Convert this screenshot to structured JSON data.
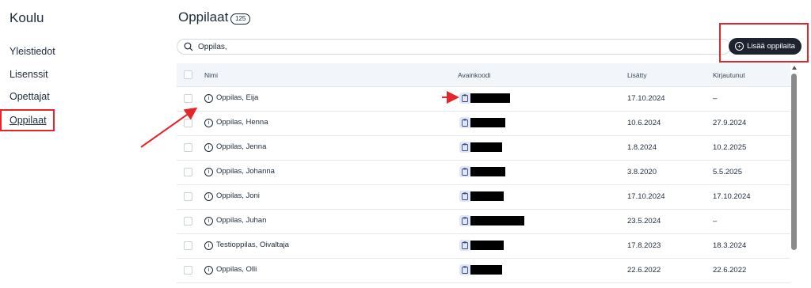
{
  "sidebar": {
    "title": "Koulu",
    "items": [
      {
        "label": "Yleistiedot"
      },
      {
        "label": "Lisenssit"
      },
      {
        "label": "Opettajat"
      },
      {
        "label": "Oppilaat",
        "active": true
      }
    ]
  },
  "main": {
    "title": "Oppilaat",
    "count": "125",
    "search": {
      "value": "Oppilas,",
      "icon": "search-icon"
    },
    "add_button": {
      "label": "Lisää oppilaita",
      "icon": "plus-circle-icon"
    }
  },
  "table": {
    "columns": [
      "Nimi",
      "Avainkoodi",
      "Lisätty",
      "Kirjautunut"
    ],
    "rows": [
      {
        "name": "Oppilas, Eija",
        "added": "17.10.2024",
        "logged_in": "–"
      },
      {
        "name": "Oppilas, Henna",
        "added": "10.6.2024",
        "logged_in": "27.9.2024"
      },
      {
        "name": "Oppilas, Jenna",
        "added": "1.8.2024",
        "logged_in": "10.2.2025"
      },
      {
        "name": "Oppilas, Johanna",
        "added": "3.8.2020",
        "logged_in": "5.5.2025"
      },
      {
        "name": "Oppilas, Joni",
        "added": "17.10.2024",
        "logged_in": "17.10.2024"
      },
      {
        "name": "Oppilas, Juhan",
        "added": "23.5.2024",
        "logged_in": "–"
      },
      {
        "name": "Testioppilas, Oivaltaja",
        "added": "17.8.2023",
        "logged_in": "18.3.2024"
      },
      {
        "name": "Oppilas, Olli",
        "added": "22.6.2022",
        "logged_in": "22.6.2022"
      }
    ]
  },
  "colors": {
    "accent_dark": "#1d2430",
    "annotation_red": "#e3262c",
    "header_bg": "#f2f6fa",
    "chip_bg": "#dfe6f7"
  }
}
